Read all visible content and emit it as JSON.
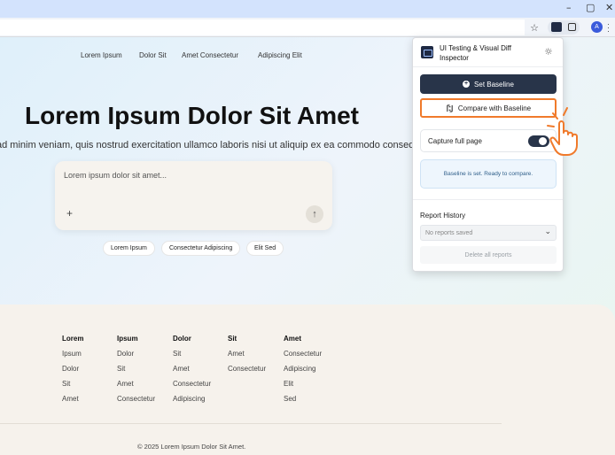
{
  "window": {
    "minimize": "–",
    "maximize": "▢",
    "close": "✕"
  },
  "toolbar": {
    "star_icon": "☆",
    "avatar_letter": "A",
    "menu_icon": "⋮"
  },
  "nav": [
    "Lorem Ipsum",
    "Dolor Sit",
    "Amet Consectetur",
    "Adipiscing Elit"
  ],
  "hero": {
    "title": "Lorem Ipsum Dolor Sit Amet",
    "subtitle": "ad minim veniam, quis nostrud exercitation ullamco laboris nisi ut aliquip ex ea commodo consequat."
  },
  "prompt": {
    "placeholder": "Lorem ipsum dolor sit amet...",
    "plus": "+",
    "send": "↑"
  },
  "chips": [
    "Lorem Ipsum",
    "Consectetur Adipiscing",
    "Elit Sed"
  ],
  "footer": {
    "columns": [
      {
        "heading": "Lorem",
        "items": [
          "Ipsum",
          "Dolor",
          "Sit",
          "Amet"
        ]
      },
      {
        "heading": "Ipsum",
        "items": [
          "Dolor",
          "Sit",
          "Amet",
          "Consectetur"
        ]
      },
      {
        "heading": "Dolor",
        "items": [
          "Sit",
          "Amet",
          "Consectetur",
          "Adipiscing"
        ]
      },
      {
        "heading": "Sit",
        "items": [
          "Amet",
          "Consectetur"
        ]
      },
      {
        "heading": "Amet",
        "items": [
          "Consectetur",
          "Adipiscing",
          "Elit",
          "Sed"
        ]
      }
    ],
    "copyright": "© 2025 Lorem Ipsum Dolor Sit Amet."
  },
  "popup": {
    "title": "UI Testing & Visual Diff Inspector",
    "set_baseline": "Set Baseline",
    "compare": "Compare with Baseline",
    "capture_label": "Capture full page",
    "capture_enabled": true,
    "status": "Baseline is set. Ready to compare.",
    "report_history": "Report History",
    "no_reports": "No reports saved",
    "delete_all": "Delete all reports",
    "accent_color": "#f07a2b",
    "primary_color": "#283449"
  }
}
